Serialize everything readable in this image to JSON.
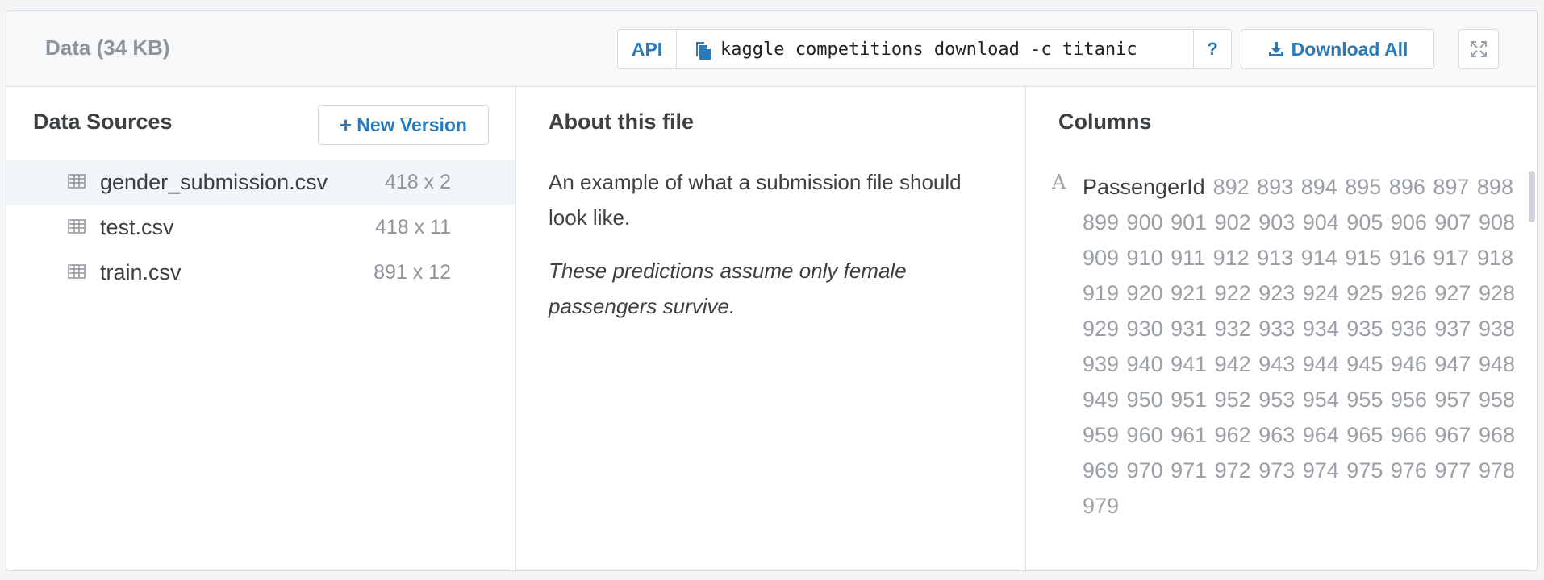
{
  "header": {
    "title": "Data (34 KB)",
    "api_label": "API",
    "command": "kaggle competitions download -c titanic",
    "help_label": "?",
    "download_all_label": "Download All"
  },
  "sources": {
    "title": "Data Sources",
    "new_version_label": "New Version",
    "files": [
      {
        "name": "gender_submission.csv",
        "dims": "418 x 2"
      },
      {
        "name": "test.csv",
        "dims": "418 x 11"
      },
      {
        "name": "train.csv",
        "dims": "891 x 12"
      }
    ]
  },
  "about": {
    "title": "About this file",
    "description": "An example of what a submission file should look like.",
    "note": "These predictions assume only female passengers survive."
  },
  "columns": {
    "title": "Columns",
    "type_icon": "A",
    "items": [
      {
        "name": "PassengerId",
        "values": "892 893 894 895 896 897 898 899 900 901 902 903 904 905 906 907 908 909 910 911 912 913 914 915 916 917 918 919 920 921 922 923 924 925 926 927 928 929 930 931 932 933 934 935 936 937 938 939 940 941 942 943 944 945 946 947 948 949 950 951 952 953 954 955 956 957 958 959 960 961 962 963 964 965 966 967 968 969 970 971 972 973 974 975 976 977 978 979"
      }
    ]
  },
  "colors": {
    "accent": "#2b7ab8",
    "muted": "#8e949a",
    "text": "#3c4043",
    "border": "#d6dbe0"
  }
}
